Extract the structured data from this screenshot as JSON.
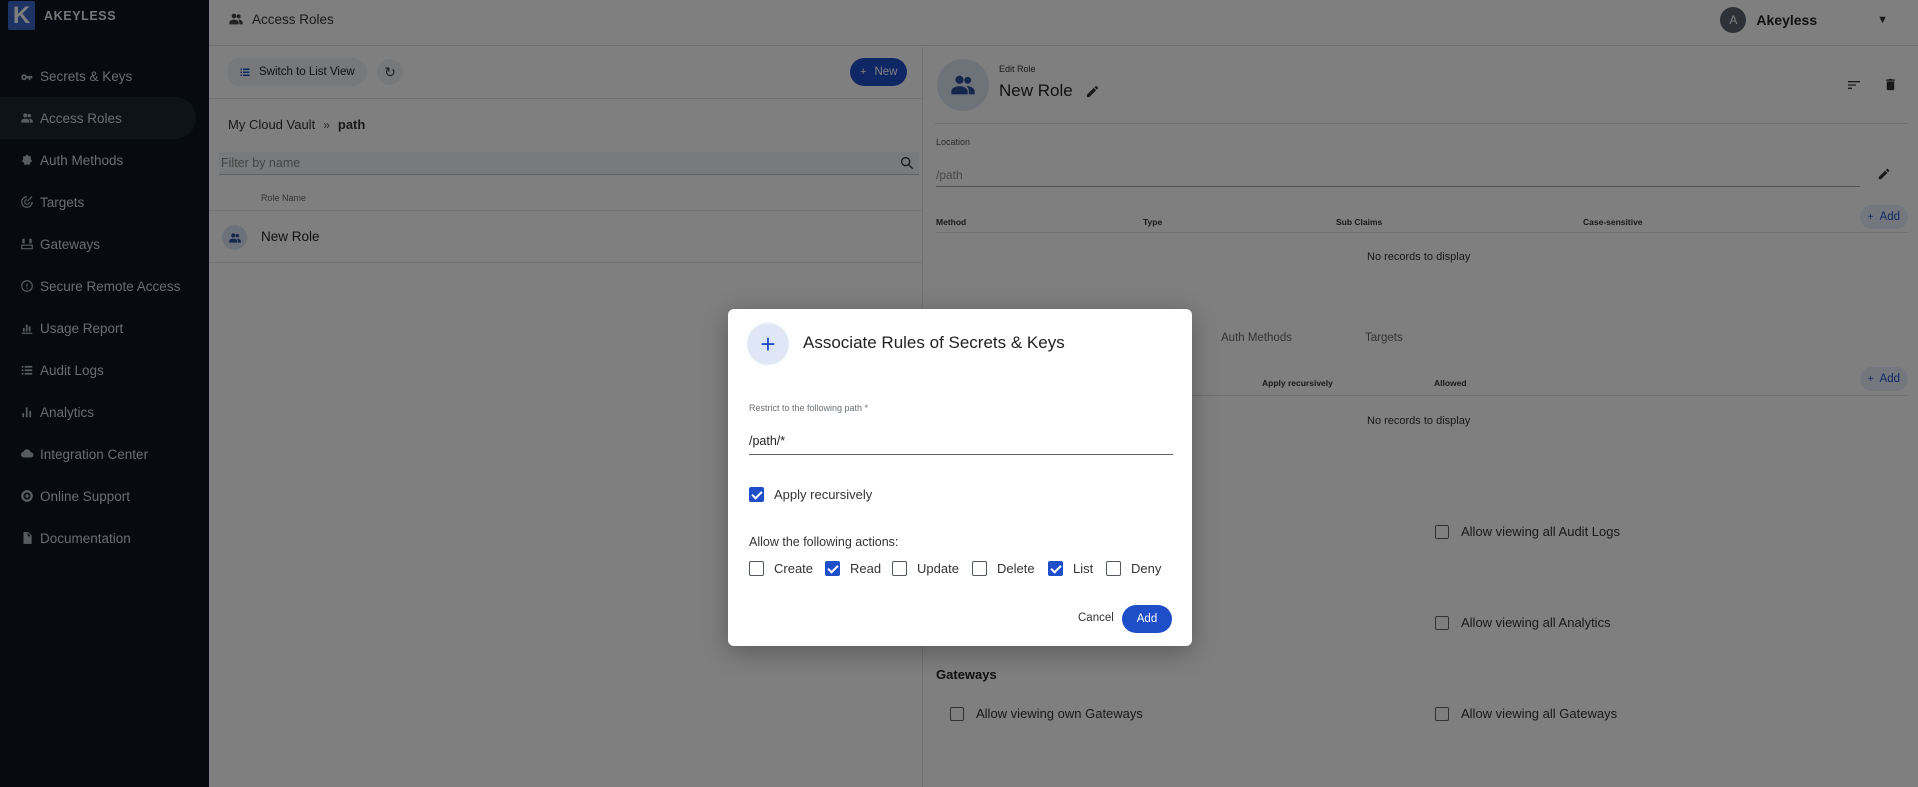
{
  "brand": {
    "logo_letter": "K",
    "name": "AKEYLESS"
  },
  "sidebar": {
    "items": [
      {
        "label": "Secrets & Keys",
        "icon": "key-icon"
      },
      {
        "label": "Access Roles",
        "icon": "people-icon",
        "active": true
      },
      {
        "label": "Auth Methods",
        "icon": "auth-icon"
      },
      {
        "label": "Targets",
        "icon": "target-icon"
      },
      {
        "label": "Gateways",
        "icon": "gateway-icon"
      },
      {
        "label": "Secure Remote Access",
        "icon": "shield-icon"
      },
      {
        "label": "Usage Report",
        "icon": "chart-icon"
      },
      {
        "label": "Audit Logs",
        "icon": "list-icon"
      },
      {
        "label": "Analytics",
        "icon": "bar-chart-icon"
      },
      {
        "label": "Integration Center",
        "icon": "cloud-icon"
      },
      {
        "label": "Online Support",
        "icon": "support-icon"
      },
      {
        "label": "Documentation",
        "icon": "document-icon"
      }
    ]
  },
  "topbar": {
    "title": "Access Roles",
    "user_initial": "A",
    "user_name": "Akeyless"
  },
  "list_panel": {
    "switch_view_label": "Switch to List View",
    "new_label": "New",
    "breadcrumb": {
      "root": "My Cloud Vault",
      "current": "path"
    },
    "filter_placeholder": "Filter by name",
    "column_header": "Role Name",
    "rows": [
      {
        "name": "New Role"
      }
    ]
  },
  "detail": {
    "edit_label": "Edit Role",
    "title": "New Role",
    "location_label": "Location",
    "location_value": "/path",
    "auth_table": {
      "headers": [
        "Method",
        "Type",
        "Sub Claims",
        "Case-sensitive"
      ],
      "add_label": "Add",
      "empty": "No records to display"
    },
    "tabs": [
      "Auth Methods",
      "Targets"
    ],
    "rules_table": {
      "headers": [
        "Apply recursively",
        "Allowed"
      ],
      "add_label": "Add",
      "empty": "No records to display"
    },
    "permissions": {
      "audit_logs_label": "Allow viewing all Audit Logs",
      "analytics_label": "Allow viewing all Analytics",
      "gateways_section": "Gateways",
      "own_gateways_label": "Allow viewing own Gateways",
      "all_gateways_label": "Allow viewing all Gateways"
    }
  },
  "dialog": {
    "title": "Associate Rules of Secrets & Keys",
    "path_label": "Restrict to the following path *",
    "path_value": "/path/*",
    "apply_recursively_label": "Apply recursively",
    "apply_recursively_checked": true,
    "actions_label": "Allow the following actions:",
    "actions": [
      {
        "label": "Create",
        "checked": false
      },
      {
        "label": "Read",
        "checked": true
      },
      {
        "label": "Update",
        "checked": false
      },
      {
        "label": "Delete",
        "checked": false
      },
      {
        "label": "List",
        "checked": true
      },
      {
        "label": "Deny",
        "checked": false
      }
    ],
    "cancel_label": "Cancel",
    "add_label": "Add"
  },
  "colors": {
    "primary": "#1f4fc8",
    "sidebar_bg": "#0e1722",
    "overlay": "rgba(0,0,0,0.5)"
  }
}
